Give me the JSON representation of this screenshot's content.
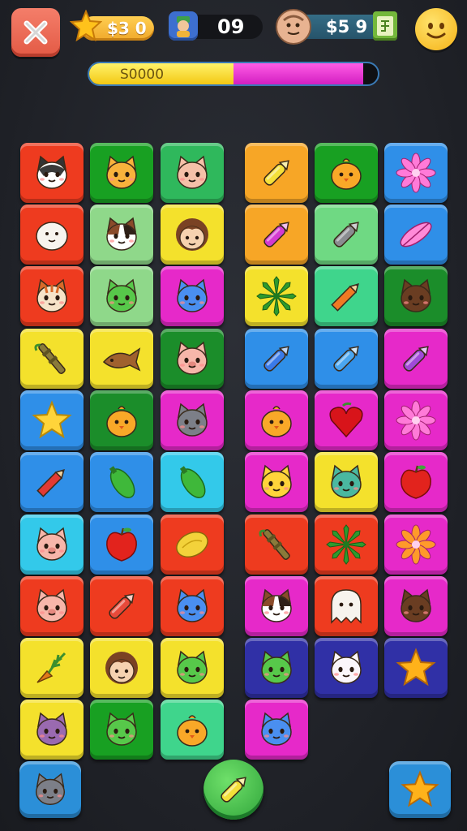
{
  "hud": {
    "coins": "$3 0",
    "moves": "09",
    "money": "$5 9",
    "progress_label": "S0000",
    "progress_fill": 0.95,
    "progress_split": 0.5,
    "icons": {
      "close": "close-icon",
      "coins": "star-icon",
      "moves": "character-badge-icon",
      "money": "face-avatar-icon",
      "card": "card-icon",
      "smile": "smiley-icon"
    }
  },
  "colors": {
    "red": "#ee3b1f",
    "green": "#18a022",
    "teal": "#2fb85c",
    "yellow": "#f4e12c",
    "orange": "#f7a626",
    "mint": "#6fd983",
    "blue": "#2f8fe8",
    "magenta": "#e629c9",
    "cyan": "#33c9ea",
    "navy": "#3030a6",
    "lightgreen": "#8fd88a",
    "seafoam": "#3fd58c",
    "darkgreen": "#1b8d2a"
  },
  "board": {
    "left": [
      [
        "red:husky-cat-icon",
        "green:orange-cat-icon",
        "teal:pink-cat-icon"
      ],
      [
        "red:white-seal-icon",
        "lightgreen:calico-cat-icon",
        "yellow:brown-hair-girl-icon"
      ],
      [
        "red:tabby-cat-icon",
        "lightgreen:green-cat-icon",
        "magenta:blue-cat-icon"
      ],
      [
        "yellow:bamboo-torch-icon",
        "yellow:wooden-fish-icon",
        "darkgreen:pink-pig-icon"
      ],
      [
        "blue:yellow-star-leaf-icon",
        "darkgreen:orange-chick-icon",
        "magenta:gray-cat-icon"
      ],
      [
        "blue:red-pencil-icon",
        "blue:green-pepper-icon",
        "cyan:green-pepper-icon"
      ],
      [
        "cyan:pink-pig-icon",
        "blue:red-apple-icon",
        "red:lemon-icon"
      ],
      [
        "red:pink-pig-icon",
        "red:red-marker-icon",
        "red:blue-cat-icon"
      ],
      [
        "yellow:carrot-sprig-icon",
        "yellow:brown-hair-girl-icon",
        "yellow:green-cat-icon"
      ],
      [
        "yellow:purple-cat-icon",
        "green:green-cat-icon",
        "seafoam:orange-chick-icon"
      ]
    ],
    "right": [
      [
        "orange:yellow-crayon-icon",
        "green:orange-chick-icon",
        "blue:pink-flower-icon"
      ],
      [
        "orange:magenta-marker-icon",
        "mint:gray-marker-icon",
        "blue:pink-feather-icon"
      ],
      [
        "yellow:green-leaf-icon",
        "seafoam:orange-pencil-icon",
        "darkgreen:brown-bear-icon"
      ],
      [
        "blue:blue-crayon-icon",
        "blue:blue-marker-icon",
        "magenta:purple-crayon-icon"
      ],
      [
        "magenta:orange-chick-icon",
        "magenta:red-heart-icon",
        "magenta:pink-flower-icon"
      ],
      [
        "magenta:yellow-cat-icon",
        "yellow:teal-bear-icon",
        "magenta:red-apple-icon"
      ],
      [
        "red:bamboo-torch-icon",
        "red:green-leaf-icon",
        "magenta:orange-flower-icon"
      ],
      [
        "magenta:calico-cat-icon",
        "red:white-ghost-icon",
        "magenta:brown-bear-icon"
      ],
      [
        "navy:green-cat-icon",
        "navy:white-cat-icon",
        "navy:gold-star-icon"
      ],
      [
        "magenta:blue-cat-icon"
      ]
    ]
  },
  "bottom_bar": {
    "left_button_icon": "gray-cat-icon",
    "center_button_icon": "yellow-crayon-icon",
    "right_button_icon": "gold-star-icon"
  }
}
